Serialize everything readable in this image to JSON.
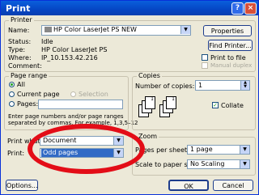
{
  "window": {
    "title": "Print"
  },
  "titlebar": {
    "help_label": "?",
    "close_label": "×"
  },
  "printer": {
    "group_label": "Printer",
    "name_label": "Name:",
    "name_value": "HP Color LaserJet PS NEW",
    "status_label": "Status:",
    "status_value": "Idle",
    "type_label": "Type:",
    "type_value": "HP Color LaserJet PS",
    "where_label": "Where:",
    "where_value": "IP_10.153.42.216",
    "comment_label": "Comment:",
    "properties_label": "Properties",
    "find_printer_label": "Find Printer...",
    "print_to_file_label": "Print to file",
    "manual_duplex_label": "Manual duplex"
  },
  "page_range": {
    "group_label": "Page range",
    "all_label": "All",
    "current_page_label": "Current page",
    "selection_label": "Selection",
    "pages_label": "Pages:",
    "help_text_1": "Enter page numbers and/or page ranges",
    "help_text_2": "separated by commas.  For example, 1,3,5–12"
  },
  "copies": {
    "group_label": "Copies",
    "number_label": "Number of copies:",
    "number_value": "1",
    "collate_label": "Collate"
  },
  "print_what": {
    "label": "Print what:",
    "value": "Document"
  },
  "print": {
    "label": "Print:",
    "value": "Odd pages"
  },
  "zoom": {
    "group_label": "Zoom",
    "pages_per_sheet_label": "Pages per sheet:",
    "pages_per_sheet_value": "1 page",
    "scale_label": "Scale to paper size:",
    "scale_value": "No Scaling"
  },
  "footer": {
    "options_label": "Options...",
    "ok_label": "OK",
    "cancel_label": "Cancel"
  }
}
